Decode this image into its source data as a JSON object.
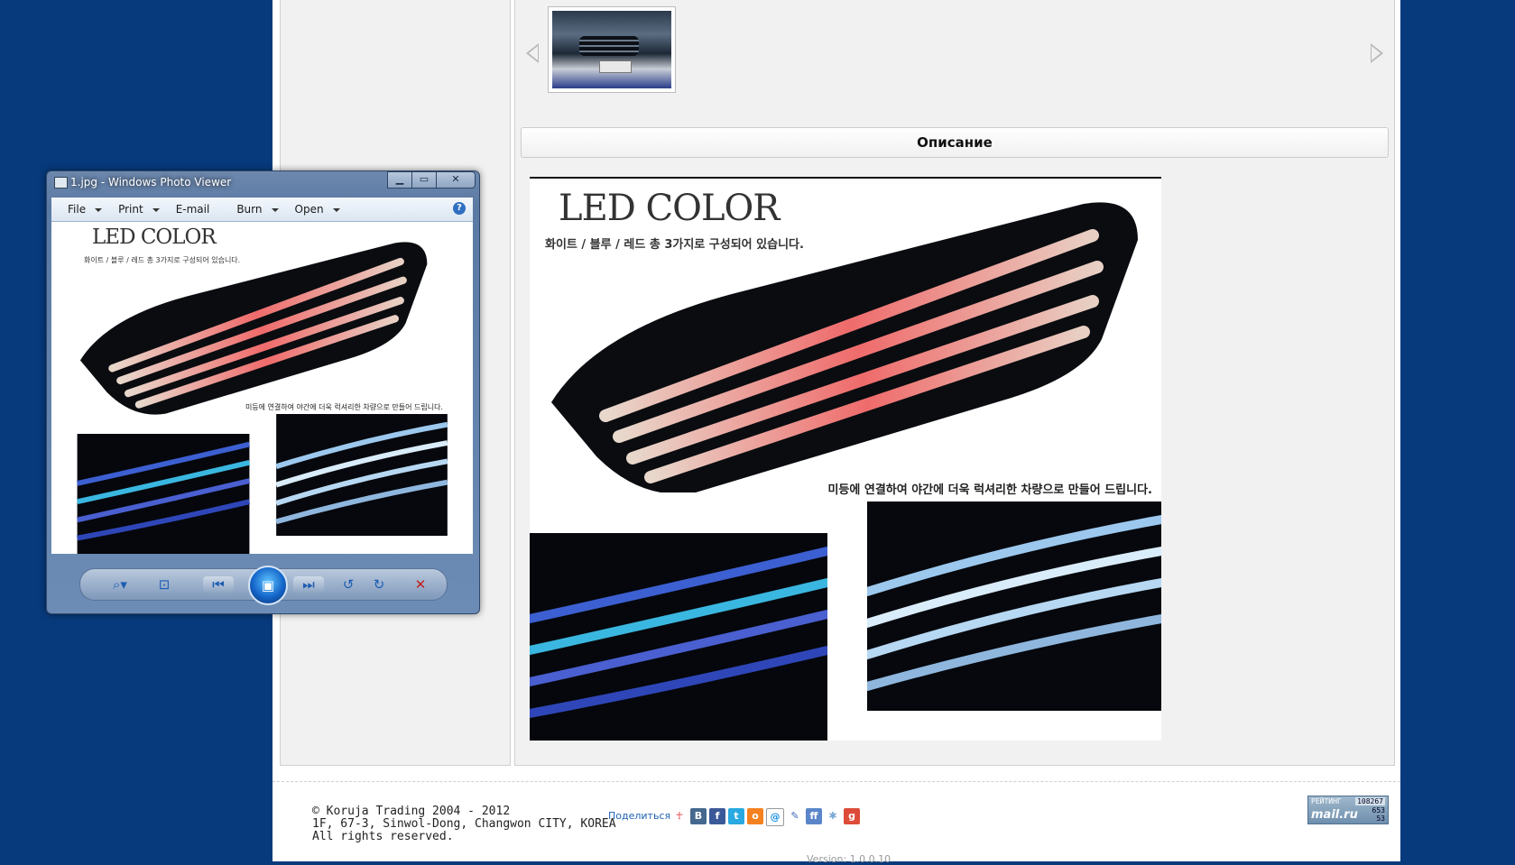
{
  "gallery": {
    "prev_label": "",
    "next_label": ""
  },
  "description": {
    "title": "Описание"
  },
  "product_image": {
    "title": "LED COLOR",
    "subtitle": "화이트 / 블루 / 레드 총 3가지로 구성되어 있습니다.",
    "caption": "미등에 연결하여 야간에 더욱 럭셔리한 차량으로 만들어 드립니다."
  },
  "footer": {
    "copyright": "© Koruja Trading 2004 - 2012",
    "address": "1F, 67-3, Sinwol-Dong, Changwon CITY, KOREA",
    "rights": "All rights reserved.",
    "share_label": "Поделиться",
    "version": "Version: 1.0.0.10"
  },
  "rating_widget": {
    "label": "РЕЙТИНГ",
    "logo": "mail.ru",
    "n1": "108267",
    "n2": "653",
    "n3": "53"
  },
  "photo_viewer": {
    "title": "1.jpg - Windows Photo Viewer",
    "menu": [
      {
        "label": "File",
        "dropdown": true
      },
      {
        "label": "Print",
        "dropdown": true
      },
      {
        "label": "E-mail",
        "dropdown": false
      },
      {
        "label": "Burn",
        "dropdown": true
      },
      {
        "label": "Open",
        "dropdown": true
      }
    ],
    "image_title": "LED COLOR",
    "image_subtitle": "화이트 / 블루 / 레드 총 3가지로 구성되어 있습니다.",
    "image_caption": "미등에 연결하여 야간에 더욱 럭셔리한 차량으로 만들어 드립니다."
  },
  "colors": {
    "background": "#073a7c",
    "panel": "#f1f1f1",
    "link": "#1e62b5"
  }
}
